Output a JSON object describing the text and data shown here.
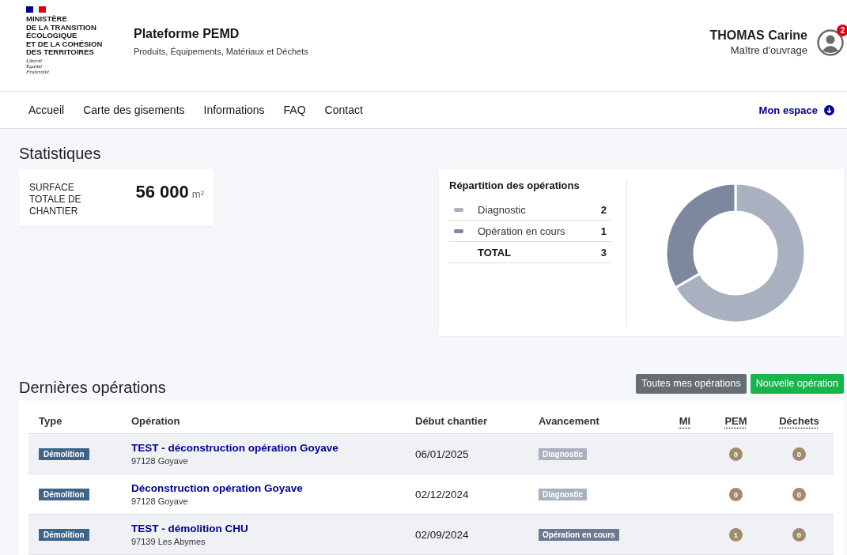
{
  "header": {
    "ministry": [
      "MINISTÈRE",
      "DE LA TRANSITION",
      "ÉCOLOGIQUE",
      "ET DE LA COHÉSION",
      "DES TERRITOIRES"
    ],
    "motto": [
      "Liberté",
      "Égalité",
      "Fraternité"
    ],
    "title": "Plateforme PEMD",
    "subtitle": "Produits, Équipements, Matériaux et Déchets",
    "user": {
      "name": "THOMAS Carine",
      "role": "Maître d'ouvrage",
      "badge": "2"
    }
  },
  "nav": {
    "items": [
      {
        "label": "Accueil"
      },
      {
        "label": "Carte des gisements"
      },
      {
        "label": "Informations"
      },
      {
        "label": "FAQ"
      },
      {
        "label": "Contact"
      }
    ],
    "account": "Mon espace"
  },
  "statistics": {
    "title": "Statistiques",
    "surface": {
      "label": "SURFACE TOTALE DE CHANTIER",
      "value": "56 000",
      "unit": "m²"
    },
    "distribution": {
      "title": "Répartition des opérations",
      "rows": [
        {
          "count": "2",
          "color": "#a9b0c0"
        },
        {
          "count": "1",
          "color": "#7d889f"
        }
      ],
      "total": {
        "label": "TOTAL",
        "count": "3"
      },
      "chart_data": {
        "type": "donut",
        "categories": [
          "Diagnostic",
          "Opération en cours"
        ],
        "values": [
          66.67,
          33.33
        ]
      }
    }
  },
  "operations": {
    "title": "Dernières opérations",
    "buttons": [
      {
        "label": "Toutes mes opérations",
        "kind": "secondary"
      },
      {
        "label": "Nouvelle opération",
        "kind": "primary"
      }
    ],
    "columns": [
      "Type",
      "Opération",
      "Début chantier",
      "Avancement",
      "MI",
      "PEM",
      "Déchets"
    ],
    "rows": [
      {
        "type": "Démolition",
        "name": "TEST - déconstruction opération Goyave",
        "place": "97128 Goyave",
        "start": "06/01/2025",
        "status": {
          "label": "Diagnostic",
          "color": "#a9b0c0"
        },
        "pem": "0",
        "waste": "0"
      },
      {
        "type": "Démolition",
        "name": "Déconstruction opération Goyave",
        "place": "97128 Goyave",
        "start": "02/12/2024",
        "status": {
          "label": "Diagnostic",
          "color": "#a9b0c0"
        },
        "pem": "0",
        "waste": "0"
      },
      {
        "type": "Démolition",
        "name": "TEST - démolition CHU",
        "place": "97139 Les Abymes",
        "start": "02/09/2024",
        "status": {
          "label": "Opération en cours",
          "color": "#6e7893"
        },
        "pem": "1",
        "waste": "0"
      }
    ]
  }
}
